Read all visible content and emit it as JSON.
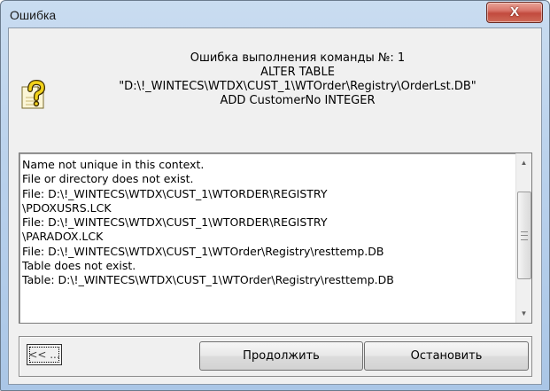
{
  "window": {
    "title": "Ошибка",
    "close_label": "X"
  },
  "message": {
    "lines": [
      "Ошибка выполнения команды №: 1",
      "ALTER TABLE",
      "\"D:\\!_WINTECS\\WTDX\\CUST_1\\WTOrder\\Registry\\OrderLst.DB\"",
      "ADD CustomerNo INTEGER"
    ],
    "icon": "question-icon"
  },
  "log": {
    "lines": [
      "Name not unique in this context.",
      "File or directory does not exist.",
      "File: D:\\!_WINTECS\\WTDX\\CUST_1\\WTORDER\\REGISTRY",
      "\\PDOXUSRS.LCK",
      "File: D:\\!_WINTECS\\WTDX\\CUST_1\\WTORDER\\REGISTRY",
      "\\PARADOX.LCK",
      "File: D:\\!_WINTECS\\WTDX\\CUST_1\\WTOrder\\Registry\\resttemp.DB",
      "Table does not exist.",
      "Table: D:\\!_WINTECS\\WTDX\\CUST_1\\WTOrder\\Registry\\resttemp.DB"
    ],
    "scroll_up": "▲",
    "scroll_down": "▼"
  },
  "buttons": {
    "toggle_label": "<< ...",
    "continue_label": "Продолжить",
    "stop_label": "Остановить"
  }
}
